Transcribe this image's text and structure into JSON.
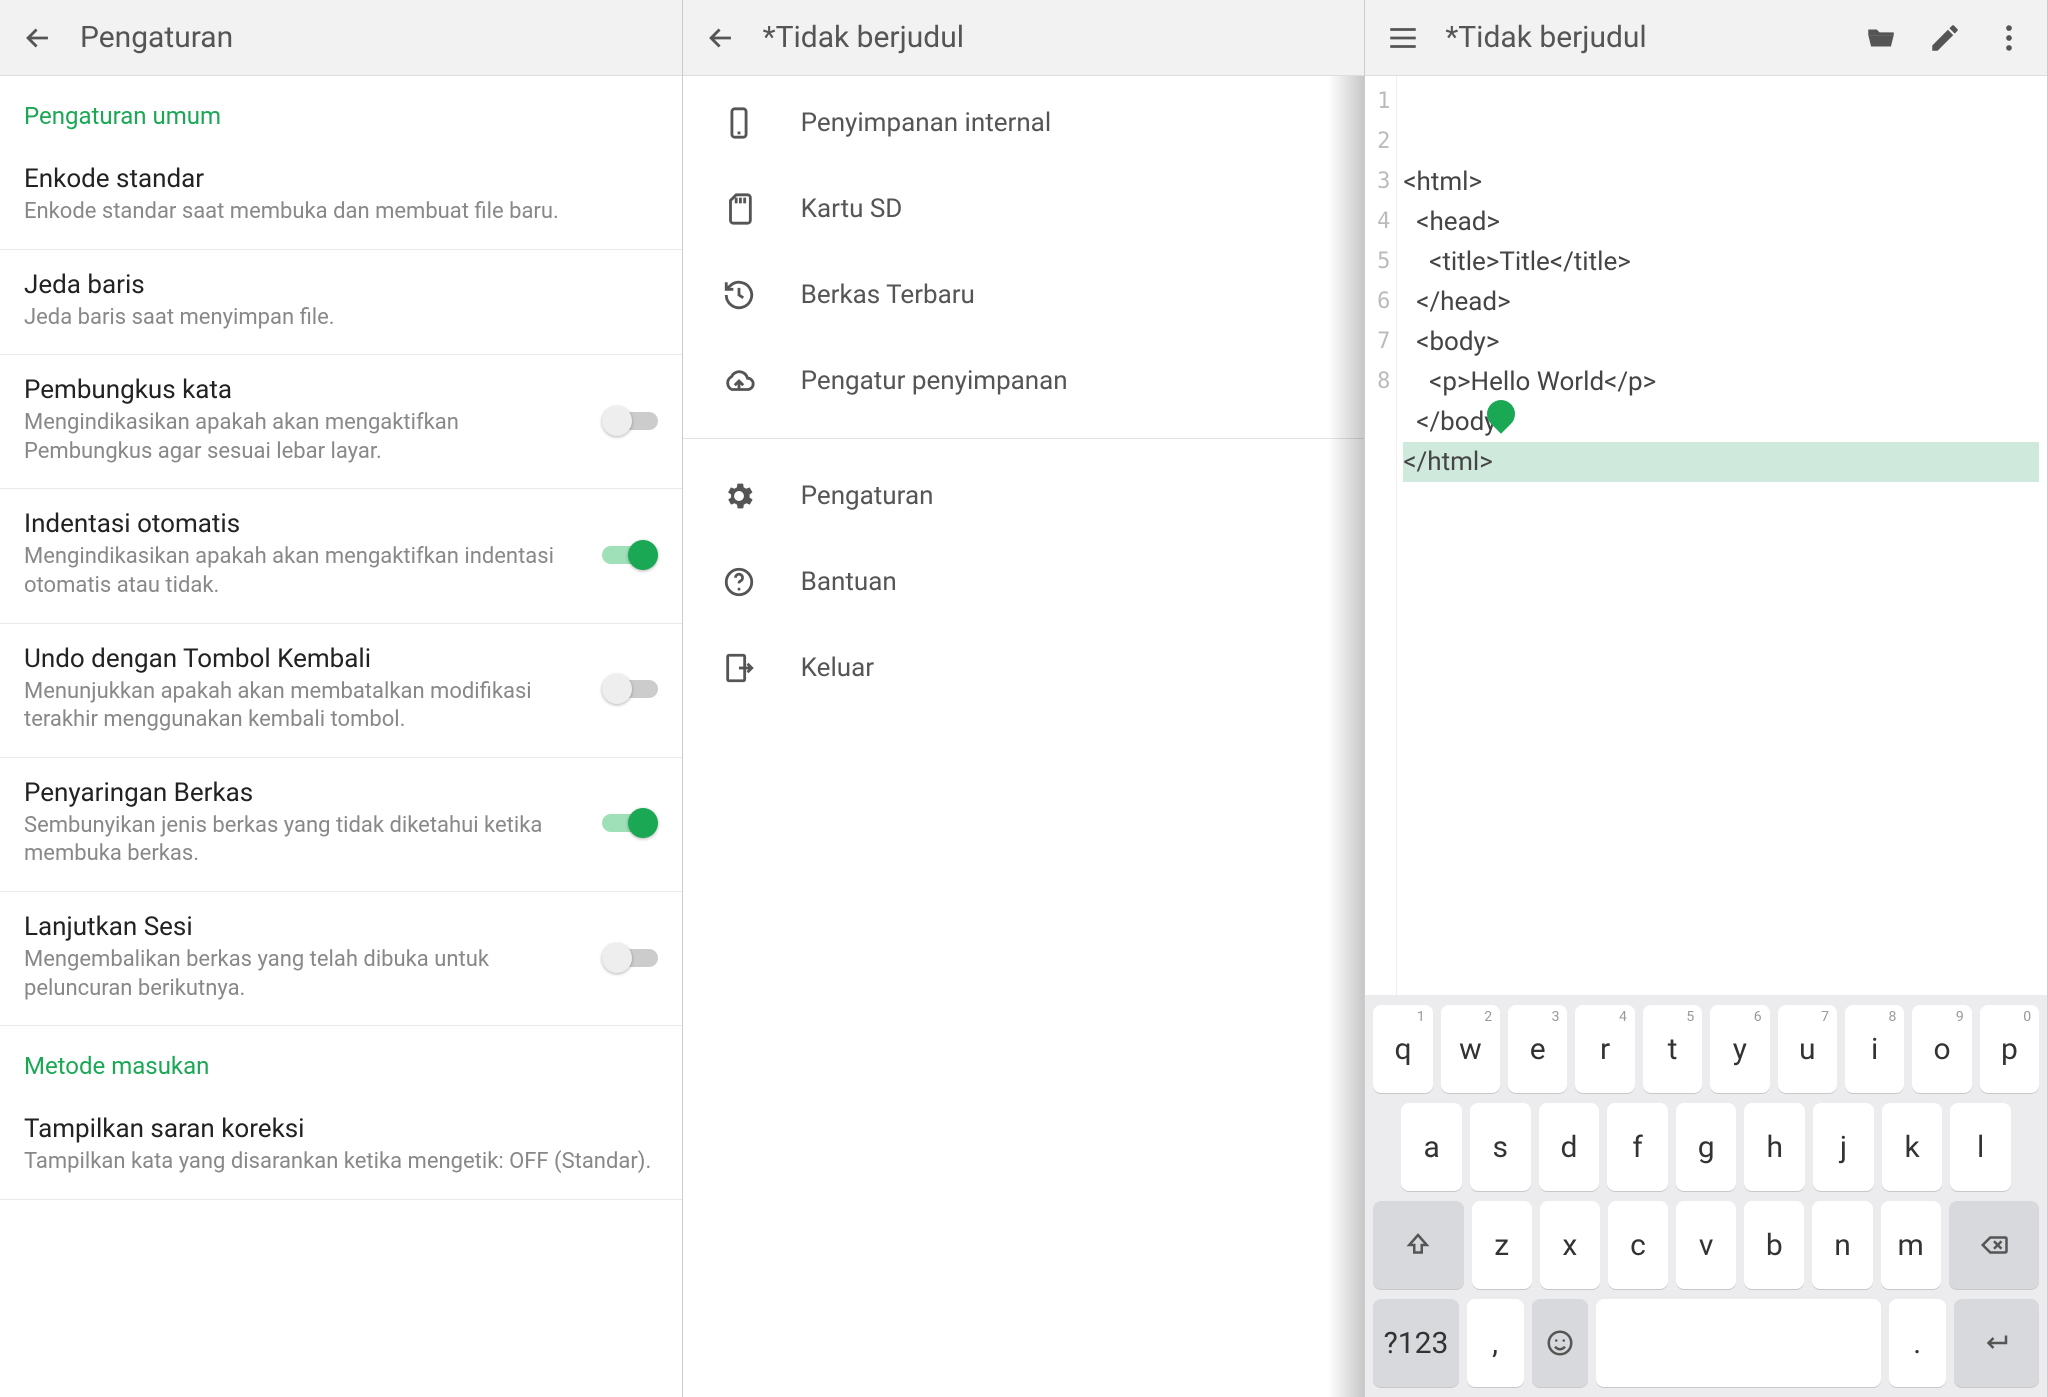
{
  "panel1": {
    "title": "Pengaturan",
    "sections": [
      {
        "header": "Pengaturan umum",
        "items": [
          {
            "title": "Enkode standar",
            "sub": "Enkode standar saat membuka dan membuat file baru.",
            "toggle": null
          },
          {
            "title": "Jeda baris",
            "sub": "Jeda baris saat menyimpan file.",
            "toggle": null
          },
          {
            "title": "Pembungkus kata",
            "sub": "Mengindikasikan apakah akan mengaktifkan Pembungkus agar sesuai lebar layar.",
            "toggle": false
          },
          {
            "title": "Indentasi otomatis",
            "sub": "Mengindikasikan apakah akan mengaktifkan indentasi otomatis atau tidak.",
            "toggle": true
          },
          {
            "title": "Undo dengan Tombol Kembali",
            "sub": "Menunjukkan apakah akan membatalkan modifikasi terakhir menggunakan kembali tombol.",
            "toggle": false
          },
          {
            "title": "Penyaringan Berkas",
            "sub": "Sembunyikan jenis berkas yang tidak diketahui ketika membuka berkas.",
            "toggle": true
          },
          {
            "title": "Lanjutkan Sesi",
            "sub": "Mengembalikan berkas yang telah dibuka untuk peluncuran berikutnya.",
            "toggle": false
          }
        ]
      },
      {
        "header": "Metode masukan",
        "items": [
          {
            "title": "Tampilkan saran koreksi",
            "sub": "Tampilkan kata yang disarankan ketika mengetik: OFF (Standar).",
            "toggle": null
          }
        ]
      }
    ]
  },
  "panel2": {
    "title": "*Tidak berjudul",
    "drawer": {
      "groups": [
        [
          {
            "icon": "phone-icon",
            "label": "Penyimpanan internal"
          },
          {
            "icon": "sdcard-icon",
            "label": "Kartu SD"
          },
          {
            "icon": "history-icon",
            "label": "Berkas Terbaru"
          },
          {
            "icon": "cloud-icon",
            "label": "Pengatur penyimpanan"
          }
        ],
        [
          {
            "icon": "gear-icon",
            "label": "Pengaturan"
          },
          {
            "icon": "help-icon",
            "label": "Bantuan"
          },
          {
            "icon": "exit-icon",
            "label": "Keluar"
          }
        ]
      ]
    }
  },
  "panel3": {
    "title": "*Tidak berjudul",
    "code_lines": [
      "<html>",
      "  <head>",
      "    <title>Title</title>",
      "  </head>",
      "  <body>",
      "    <p>Hello World</p>",
      "  </body>",
      "</html>"
    ],
    "current_line_index": 7
  },
  "keyboard": {
    "row1": [
      "q",
      "w",
      "e",
      "r",
      "t",
      "y",
      "u",
      "i",
      "o",
      "p"
    ],
    "row1_sup": [
      "1",
      "2",
      "3",
      "4",
      "5",
      "6",
      "7",
      "8",
      "9",
      "0"
    ],
    "row2": [
      "a",
      "s",
      "d",
      "f",
      "g",
      "h",
      "j",
      "k",
      "l"
    ],
    "row3": [
      "z",
      "x",
      "c",
      "v",
      "b",
      "n",
      "m"
    ],
    "shift": "↑",
    "backspace": "⌫",
    "symbols": "?123",
    "comma": ",",
    "period": ".",
    "enter": "↵"
  }
}
